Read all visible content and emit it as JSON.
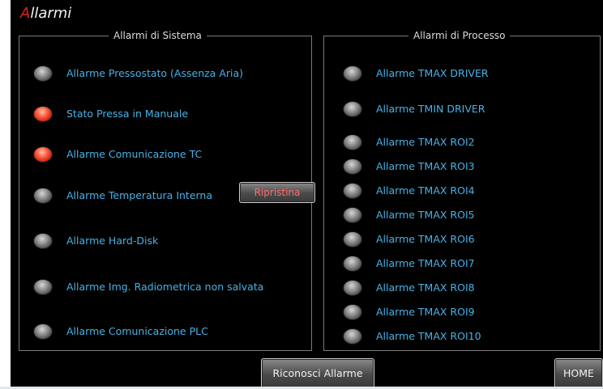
{
  "header": {
    "title_first_letter": "A",
    "title_rest": "llarmi"
  },
  "system": {
    "legend": "Allarmi di Sistema",
    "alarms": [
      {
        "label": "Allarme Pressostato (Assenza Aria)",
        "active": false
      },
      {
        "label": "Stato Pressa in Manuale",
        "active": true
      },
      {
        "label": "Allarme Comunicazione TC",
        "active": true
      },
      {
        "label": "Allarme Temperatura Interna",
        "active": false
      },
      {
        "label": "Allarme Hard-Disk",
        "active": false
      },
      {
        "label": "Allarme Img. Radiometrica non salvata",
        "active": false
      },
      {
        "label": "Allarme Comunicazione PLC",
        "active": false
      }
    ],
    "reset_label": "Ripristina"
  },
  "process": {
    "legend": "Allarmi di Processo",
    "alarms": [
      {
        "label": "Allarme TMAX DRIVER",
        "active": false
      },
      {
        "label": "Allarme TMIN DRIVER",
        "active": false
      },
      {
        "label": "Allarme TMAX ROI2",
        "active": false
      },
      {
        "label": "Allarme TMAX ROI3",
        "active": false
      },
      {
        "label": "Allarme TMAX ROI4",
        "active": false
      },
      {
        "label": "Allarme TMAX ROI5",
        "active": false
      },
      {
        "label": "Allarme TMAX ROI6",
        "active": false
      },
      {
        "label": "Allarme TMAX ROI7",
        "active": false
      },
      {
        "label": "Allarme TMAX ROI8",
        "active": false
      },
      {
        "label": "Allarme TMAX ROI9",
        "active": false
      },
      {
        "label": "Allarme TMAX ROI10",
        "active": false
      }
    ]
  },
  "footer": {
    "ack_label": "Riconosci Allarme",
    "home_label": "HOME"
  },
  "colors": {
    "label": "#46b2e6",
    "led_on": "#e8402a",
    "led_off": "#7a7a7a",
    "title_accent": "#e02020"
  }
}
